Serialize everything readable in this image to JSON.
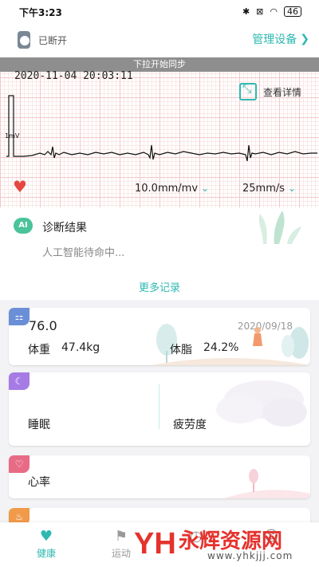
{
  "status": {
    "time": "下午3:23",
    "battery": "46"
  },
  "device": {
    "connection": "已断开",
    "manage_label": "管理设备"
  },
  "ecg": {
    "sync_banner": "下拉开始同步",
    "timestamp": "2020-11-04 20:03:11",
    "detail_label": "查看详情",
    "calibration_label": "1mV",
    "gain": "10.0mm/mv",
    "speed": "25mm/s"
  },
  "diagnosis": {
    "badge": "AI",
    "title": "诊断结果",
    "message": "人工智能待命中...",
    "more": "更多记录"
  },
  "weight_card": {
    "value": "76.0",
    "date": "2020/09/18",
    "weight_label": "体重",
    "weight_value": "47.4kg",
    "fat_label": "体脂",
    "fat_value": "24.2%"
  },
  "sleep_card": {
    "sleep_label": "睡眠",
    "fatigue_label": "疲劳度"
  },
  "heart_card": {
    "label": "心率"
  },
  "tabs": [
    {
      "label": "健康",
      "icon": "heart-pulse-icon",
      "active": true
    },
    {
      "label": "运动",
      "icon": "runner-icon",
      "active": false
    },
    {
      "label": "",
      "icon": "device-icon",
      "active": false
    },
    {
      "label": "",
      "icon": "profile-icon",
      "active": false
    }
  ],
  "watermark": {
    "logo": "YH",
    "name": "永辉资源网",
    "url": "www.yhkjjj.com"
  },
  "colors": {
    "accent": "#2eb8b0",
    "heart": "#e4473f",
    "weight_icon": "#6b8fd6",
    "sleep_icon": "#a67be6",
    "heart_icon": "#e86b86",
    "bottom_icon": "#f09a4a"
  }
}
